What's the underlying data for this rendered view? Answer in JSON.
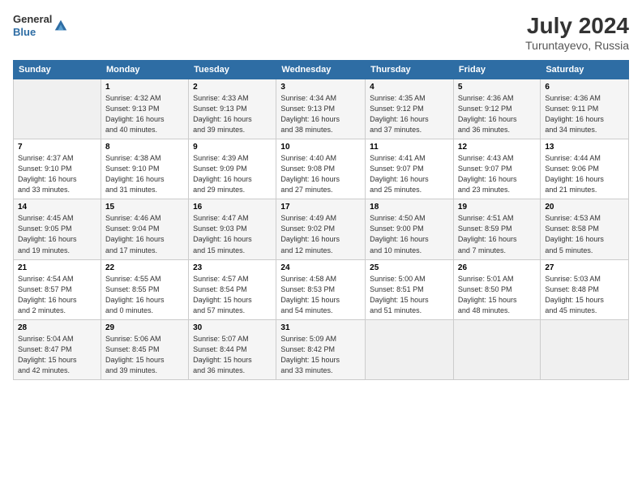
{
  "header": {
    "logo_line1": "General",
    "logo_line2": "Blue",
    "month_year": "July 2024",
    "location": "Turuntayevo, Russia"
  },
  "weekdays": [
    "Sunday",
    "Monday",
    "Tuesday",
    "Wednesday",
    "Thursday",
    "Friday",
    "Saturday"
  ],
  "weeks": [
    [
      {
        "day": "",
        "info": ""
      },
      {
        "day": "1",
        "info": "Sunrise: 4:32 AM\nSunset: 9:13 PM\nDaylight: 16 hours\nand 40 minutes."
      },
      {
        "day": "2",
        "info": "Sunrise: 4:33 AM\nSunset: 9:13 PM\nDaylight: 16 hours\nand 39 minutes."
      },
      {
        "day": "3",
        "info": "Sunrise: 4:34 AM\nSunset: 9:13 PM\nDaylight: 16 hours\nand 38 minutes."
      },
      {
        "day": "4",
        "info": "Sunrise: 4:35 AM\nSunset: 9:12 PM\nDaylight: 16 hours\nand 37 minutes."
      },
      {
        "day": "5",
        "info": "Sunrise: 4:36 AM\nSunset: 9:12 PM\nDaylight: 16 hours\nand 36 minutes."
      },
      {
        "day": "6",
        "info": "Sunrise: 4:36 AM\nSunset: 9:11 PM\nDaylight: 16 hours\nand 34 minutes."
      }
    ],
    [
      {
        "day": "7",
        "info": "Sunrise: 4:37 AM\nSunset: 9:10 PM\nDaylight: 16 hours\nand 33 minutes."
      },
      {
        "day": "8",
        "info": "Sunrise: 4:38 AM\nSunset: 9:10 PM\nDaylight: 16 hours\nand 31 minutes."
      },
      {
        "day": "9",
        "info": "Sunrise: 4:39 AM\nSunset: 9:09 PM\nDaylight: 16 hours\nand 29 minutes."
      },
      {
        "day": "10",
        "info": "Sunrise: 4:40 AM\nSunset: 9:08 PM\nDaylight: 16 hours\nand 27 minutes."
      },
      {
        "day": "11",
        "info": "Sunrise: 4:41 AM\nSunset: 9:07 PM\nDaylight: 16 hours\nand 25 minutes."
      },
      {
        "day": "12",
        "info": "Sunrise: 4:43 AM\nSunset: 9:07 PM\nDaylight: 16 hours\nand 23 minutes."
      },
      {
        "day": "13",
        "info": "Sunrise: 4:44 AM\nSunset: 9:06 PM\nDaylight: 16 hours\nand 21 minutes."
      }
    ],
    [
      {
        "day": "14",
        "info": "Sunrise: 4:45 AM\nSunset: 9:05 PM\nDaylight: 16 hours\nand 19 minutes."
      },
      {
        "day": "15",
        "info": "Sunrise: 4:46 AM\nSunset: 9:04 PM\nDaylight: 16 hours\nand 17 minutes."
      },
      {
        "day": "16",
        "info": "Sunrise: 4:47 AM\nSunset: 9:03 PM\nDaylight: 16 hours\nand 15 minutes."
      },
      {
        "day": "17",
        "info": "Sunrise: 4:49 AM\nSunset: 9:02 PM\nDaylight: 16 hours\nand 12 minutes."
      },
      {
        "day": "18",
        "info": "Sunrise: 4:50 AM\nSunset: 9:00 PM\nDaylight: 16 hours\nand 10 minutes."
      },
      {
        "day": "19",
        "info": "Sunrise: 4:51 AM\nSunset: 8:59 PM\nDaylight: 16 hours\nand 7 minutes."
      },
      {
        "day": "20",
        "info": "Sunrise: 4:53 AM\nSunset: 8:58 PM\nDaylight: 16 hours\nand 5 minutes."
      }
    ],
    [
      {
        "day": "21",
        "info": "Sunrise: 4:54 AM\nSunset: 8:57 PM\nDaylight: 16 hours\nand 2 minutes."
      },
      {
        "day": "22",
        "info": "Sunrise: 4:55 AM\nSunset: 8:55 PM\nDaylight: 16 hours\nand 0 minutes."
      },
      {
        "day": "23",
        "info": "Sunrise: 4:57 AM\nSunset: 8:54 PM\nDaylight: 15 hours\nand 57 minutes."
      },
      {
        "day": "24",
        "info": "Sunrise: 4:58 AM\nSunset: 8:53 PM\nDaylight: 15 hours\nand 54 minutes."
      },
      {
        "day": "25",
        "info": "Sunrise: 5:00 AM\nSunset: 8:51 PM\nDaylight: 15 hours\nand 51 minutes."
      },
      {
        "day": "26",
        "info": "Sunrise: 5:01 AM\nSunset: 8:50 PM\nDaylight: 15 hours\nand 48 minutes."
      },
      {
        "day": "27",
        "info": "Sunrise: 5:03 AM\nSunset: 8:48 PM\nDaylight: 15 hours\nand 45 minutes."
      }
    ],
    [
      {
        "day": "28",
        "info": "Sunrise: 5:04 AM\nSunset: 8:47 PM\nDaylight: 15 hours\nand 42 minutes."
      },
      {
        "day": "29",
        "info": "Sunrise: 5:06 AM\nSunset: 8:45 PM\nDaylight: 15 hours\nand 39 minutes."
      },
      {
        "day": "30",
        "info": "Sunrise: 5:07 AM\nSunset: 8:44 PM\nDaylight: 15 hours\nand 36 minutes."
      },
      {
        "day": "31",
        "info": "Sunrise: 5:09 AM\nSunset: 8:42 PM\nDaylight: 15 hours\nand 33 minutes."
      },
      {
        "day": "",
        "info": ""
      },
      {
        "day": "",
        "info": ""
      },
      {
        "day": "",
        "info": ""
      }
    ]
  ]
}
